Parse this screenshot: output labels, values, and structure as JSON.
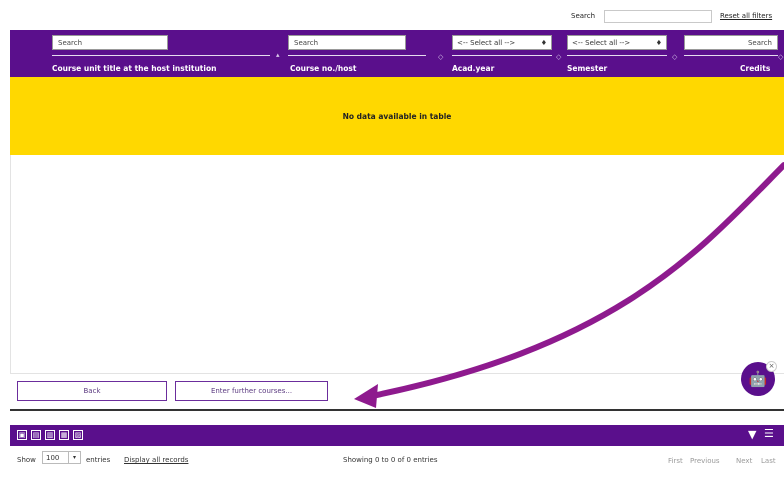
{
  "top_search": {
    "label": "Search",
    "value": "",
    "reset_label": "Reset all filters"
  },
  "table": {
    "columns": [
      {
        "filter": "Search",
        "label": "Course unit title at the host institution"
      },
      {
        "filter": "Search",
        "label": "Course no./host"
      },
      {
        "filter": "<-- Select all -->",
        "label": "Acad.year"
      },
      {
        "filter": "<-- Select all -->",
        "label": "Semester"
      },
      {
        "filter": "Search",
        "label": "Credits"
      }
    ],
    "empty_message": "No data available in table"
  },
  "buttons": {
    "back": "Back",
    "enter_further": "Enter further courses..."
  },
  "footer": {
    "show_label": "Show",
    "entries_per_page": "100",
    "entries_label": "entries",
    "display_all": "Display all records",
    "showing": "Showing 0 to 0 of 0 entries",
    "pagination": [
      "First",
      "Previous",
      "Next",
      "Last"
    ]
  },
  "colors": {
    "header": "#5a0f8c",
    "empty_row": "#ffd800",
    "annotation_arrow": "#8e1a8e"
  },
  "icons": [
    "pdf-export-icon",
    "excel-export-icon",
    "table-view-icon",
    "columns-icon",
    "image-export-icon",
    "filter-icon",
    "settings-sliders-icon",
    "chatbot-icon",
    "close-icon"
  ]
}
